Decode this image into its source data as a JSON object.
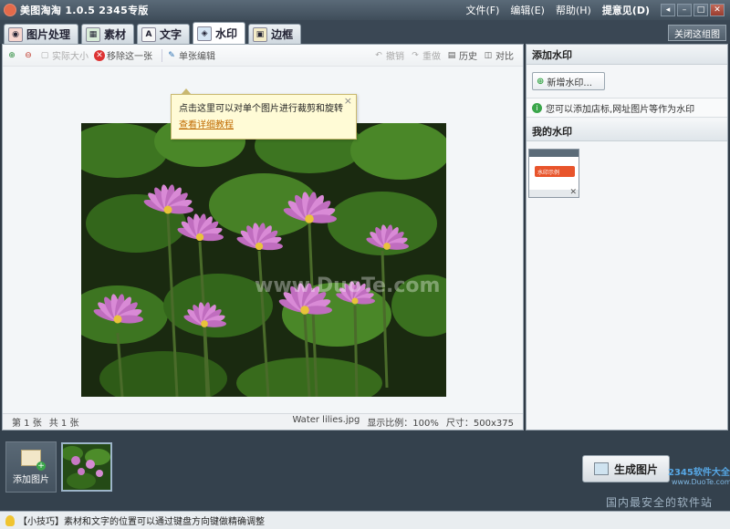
{
  "app": {
    "title": "美图淘淘 1.0.5 2345专版",
    "menu": [
      "文件(F)",
      "编辑(E)",
      "帮助(H)",
      "提意见(D)"
    ]
  },
  "tabs": [
    {
      "label": "图片处理",
      "icon": "photo-process-icon"
    },
    {
      "label": "素材",
      "icon": "material-icon"
    },
    {
      "label": "文字",
      "icon": "text-icon"
    },
    {
      "label": "水印",
      "icon": "watermark-icon",
      "active": true
    },
    {
      "label": "边框",
      "icon": "frame-icon"
    }
  ],
  "close_image_label": "关闭这组图",
  "toolbar": {
    "actual_size": "实际大小",
    "remove_one": "移除这一张",
    "single_edit": "单张编辑",
    "undo": "撤销",
    "redo": "重做",
    "history": "历史",
    "compare": "对比"
  },
  "tooltip": {
    "text": "点击这里可以对单个图片进行裁剪和旋转",
    "link": "查看详细教程"
  },
  "photo": {
    "watermark_text": "www.DuoTe.com"
  },
  "status": {
    "current": "第 1 张",
    "total": "共 1 张",
    "filename": "Water lilies.jpg",
    "scale": "显示比例：100%",
    "size": "尺寸：500x375"
  },
  "side": {
    "add_watermark_title": "添加水印",
    "add_watermark_button": "新增水印...",
    "info": "您可以添加店标,网址图片等作为水印",
    "my_watermarks_title": "我的水印",
    "thumb_label": "水印示例"
  },
  "bottom": {
    "add_image": "添加图片",
    "generate": "生成图片",
    "brand_logo": "2345软件大全",
    "brand_url": "www.DuoTe.com",
    "brand_slogan": "国内最安全的软件站"
  },
  "tip": "【小技巧】素材和文字的位置可以通过键盘方向键做精确调整",
  "colors": {
    "accent": "#3aa64a",
    "watermark_badge": "#e8542b",
    "chrome_dark": "#34414d"
  }
}
